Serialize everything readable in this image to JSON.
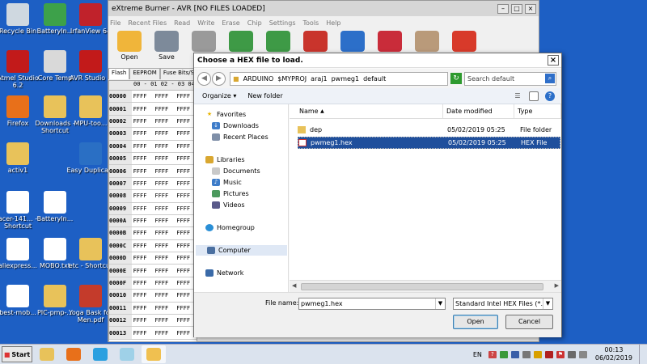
{
  "desktop": {
    "icons": [
      {
        "label": "Recycle Bin",
        "icon": "recycle-bin-icon",
        "color": "#cfd8e0"
      },
      {
        "label": "BatteryIn...",
        "icon": "battery-app-icon",
        "color": "#3da14a"
      },
      {
        "label": "IrfanView 64",
        "icon": "irfanview-icon",
        "color": "#c0222b"
      },
      {
        "label": "Atmel Studio 6.2",
        "icon": "ladybug-icon",
        "color": "#c21a1a"
      },
      {
        "label": "Core Temp",
        "icon": "thermometer-icon",
        "color": "#d9d9d9"
      },
      {
        "label": "AVR Studio 4",
        "icon": "ladybug-icon",
        "color": "#c21a1a"
      },
      {
        "label": "Firefox",
        "icon": "firefox-icon",
        "color": "#e8701a"
      },
      {
        "label": "Downloads - Shortcut",
        "icon": "folder-icon",
        "color": "#e8c25a"
      },
      {
        "label": "MPU-too...",
        "icon": "folder-icon",
        "color": "#e8c25a"
      },
      {
        "label": "activ1",
        "icon": "folder-icon",
        "color": "#e8c25a"
      },
      {
        "label": "Easy Duplica...",
        "icon": "people-icon",
        "color": "#2a6fc4"
      },
      {
        "label": "acer-141... - Shortcut",
        "icon": "document-icon",
        "color": "#ffffff"
      },
      {
        "label": "BatteryIn...",
        "icon": "document-icon",
        "color": "#ffffff"
      },
      {
        "label": "aliexpress...",
        "icon": "document-icon",
        "color": "#ffffff"
      },
      {
        "label": "MOBO.txt",
        "icon": "text-file-icon",
        "color": "#ffffff"
      },
      {
        "label": "etc - Shortcut",
        "icon": "folder-icon",
        "color": "#e8c25a"
      },
      {
        "label": "best-mob...",
        "icon": "document-icon",
        "color": "#ffffff"
      },
      {
        "label": "PIC-pmp-...",
        "icon": "folder-icon",
        "color": "#e8c25a"
      },
      {
        "label": "Yoga Bask for Men.pdf",
        "icon": "pdf-icon",
        "color": "#c43b2b"
      }
    ]
  },
  "app": {
    "title": "eXtreme Burner - AVR [NO FILES LOADED]",
    "menu": [
      "File",
      "Recent Files",
      "Read",
      "Write",
      "Erase",
      "Chip",
      "Settings",
      "Tools",
      "Help"
    ],
    "toolbar": [
      {
        "label": "Open",
        "icon": "folder-open-icon",
        "color": "#f0b53a"
      },
      {
        "label": "Save",
        "icon": "floppy-save-icon",
        "color": "#7d8a9a"
      },
      {
        "label": "Re",
        "icon": "reload-icon",
        "color": "#9a9a9a"
      },
      {
        "label": "",
        "icon": "chip-up-icon",
        "color": "#3e9a46"
      },
      {
        "label": "",
        "icon": "chip-down-icon",
        "color": "#3e9a46"
      },
      {
        "label": "",
        "icon": "chip-erase-icon",
        "color": "#c9342c"
      },
      {
        "label": "",
        "icon": "info-icon",
        "color": "#2c6fc9"
      },
      {
        "label": "",
        "icon": "help-icon",
        "color": "#c92c3a"
      },
      {
        "label": "",
        "icon": "dog-photo-icon",
        "color": "#b99a7a"
      },
      {
        "label": "",
        "icon": "donate-icon",
        "color": "#d83a2a"
      }
    ],
    "tabs": [
      "Flash",
      "EEPROM",
      "Fuse Bits/S"
    ],
    "grid_header": "00 - 01 02 - 03 04 -",
    "rows": [
      {
        "addr": "00000",
        "c1": "FFFF",
        "c2": "FFFF",
        "c3": "FFFF"
      },
      {
        "addr": "00001",
        "c1": "FFFF",
        "c2": "FFFF",
        "c3": "FFFF"
      },
      {
        "addr": "00002",
        "c1": "FFFF",
        "c2": "FFFF",
        "c3": "FFFF"
      },
      {
        "addr": "00003",
        "c1": "FFFF",
        "c2": "FFFF",
        "c3": "FFFF"
      },
      {
        "addr": "00004",
        "c1": "FFFF",
        "c2": "FFFF",
        "c3": "FFFF"
      },
      {
        "addr": "00005",
        "c1": "FFFF",
        "c2": "FFFF",
        "c3": "FFFF"
      },
      {
        "addr": "00006",
        "c1": "FFFF",
        "c2": "FFFF",
        "c3": "FFFF"
      },
      {
        "addr": "00007",
        "c1": "FFFF",
        "c2": "FFFF",
        "c3": "FFFF"
      },
      {
        "addr": "00008",
        "c1": "FFFF",
        "c2": "FFFF",
        "c3": "FFFF"
      },
      {
        "addr": "00009",
        "c1": "FFFF",
        "c2": "FFFF",
        "c3": "FFFF"
      },
      {
        "addr": "0000A",
        "c1": "FFFF",
        "c2": "FFFF",
        "c3": "FFFF"
      },
      {
        "addr": "0000B",
        "c1": "FFFF",
        "c2": "FFFF",
        "c3": "FFFF"
      },
      {
        "addr": "0000C",
        "c1": "FFFF",
        "c2": "FFFF",
        "c3": "FFFF"
      },
      {
        "addr": "0000D",
        "c1": "FFFF",
        "c2": "FFFF",
        "c3": "FFFF"
      },
      {
        "addr": "0000E",
        "c1": "FFFF",
        "c2": "FFFF",
        "c3": "FFFF"
      },
      {
        "addr": "0000F",
        "c1": "FFFF",
        "c2": "FFFF",
        "c3": "FFFF"
      },
      {
        "addr": "00010",
        "c1": "FFFF",
        "c2": "FFFF",
        "c3": "FFFF"
      },
      {
        "addr": "00011",
        "c1": "FFFF",
        "c2": "FFFF",
        "c3": "FFFF"
      },
      {
        "addr": "00012",
        "c1": "FFFF",
        "c2": "FFFF",
        "c3": "FFFF"
      },
      {
        "addr": "00013",
        "c1": "FFFF",
        "c2": "FFFF",
        "c3": "FFFF"
      }
    ]
  },
  "dialog": {
    "title": "Choose a HEX file to load.",
    "path": [
      "ARDUINO",
      "$MYPROJ",
      "araj1",
      "pwmeg1",
      "default"
    ],
    "search_placeholder": "Search default",
    "organize": "Organize",
    "new_folder": "New folder",
    "nav": {
      "favorites": "Favorites",
      "downloads": "Downloads",
      "recent": "Recent Places",
      "libraries": "Libraries",
      "documents": "Documents",
      "music": "Music",
      "pictures": "Pictures",
      "videos": "Videos",
      "homegroup": "Homegroup",
      "computer": "Computer",
      "network": "Network"
    },
    "columns": {
      "name": "Name",
      "date": "Date modified",
      "type": "Type"
    },
    "files": [
      {
        "name": "dep",
        "date": "05/02/2019 05:25",
        "type": "File folder",
        "selected": false
      },
      {
        "name": "pwmeg1.hex",
        "date": "05/02/2019 05:25",
        "type": "HEX File",
        "selected": true
      }
    ],
    "file_name_label": "File name:",
    "file_name_value": "pwmeg1.hex",
    "file_type_value": "Standard Intel HEX Files (*.h",
    "open_label": "Open",
    "cancel_label": "Cancel"
  },
  "taskbar": {
    "start_label": "Start",
    "apps": [
      {
        "icon": "explorer-icon",
        "color": "#e8c25a"
      },
      {
        "icon": "firefox-icon",
        "color": "#e8701a"
      },
      {
        "icon": "skype-icon",
        "color": "#2aa0e0"
      },
      {
        "icon": "notepad-icon",
        "color": "#9fd1e8"
      },
      {
        "icon": "extreme-burner-icon",
        "color": "#f0c050"
      }
    ],
    "lang": "EN",
    "time": "00:13",
    "date": "06/02/2019"
  }
}
